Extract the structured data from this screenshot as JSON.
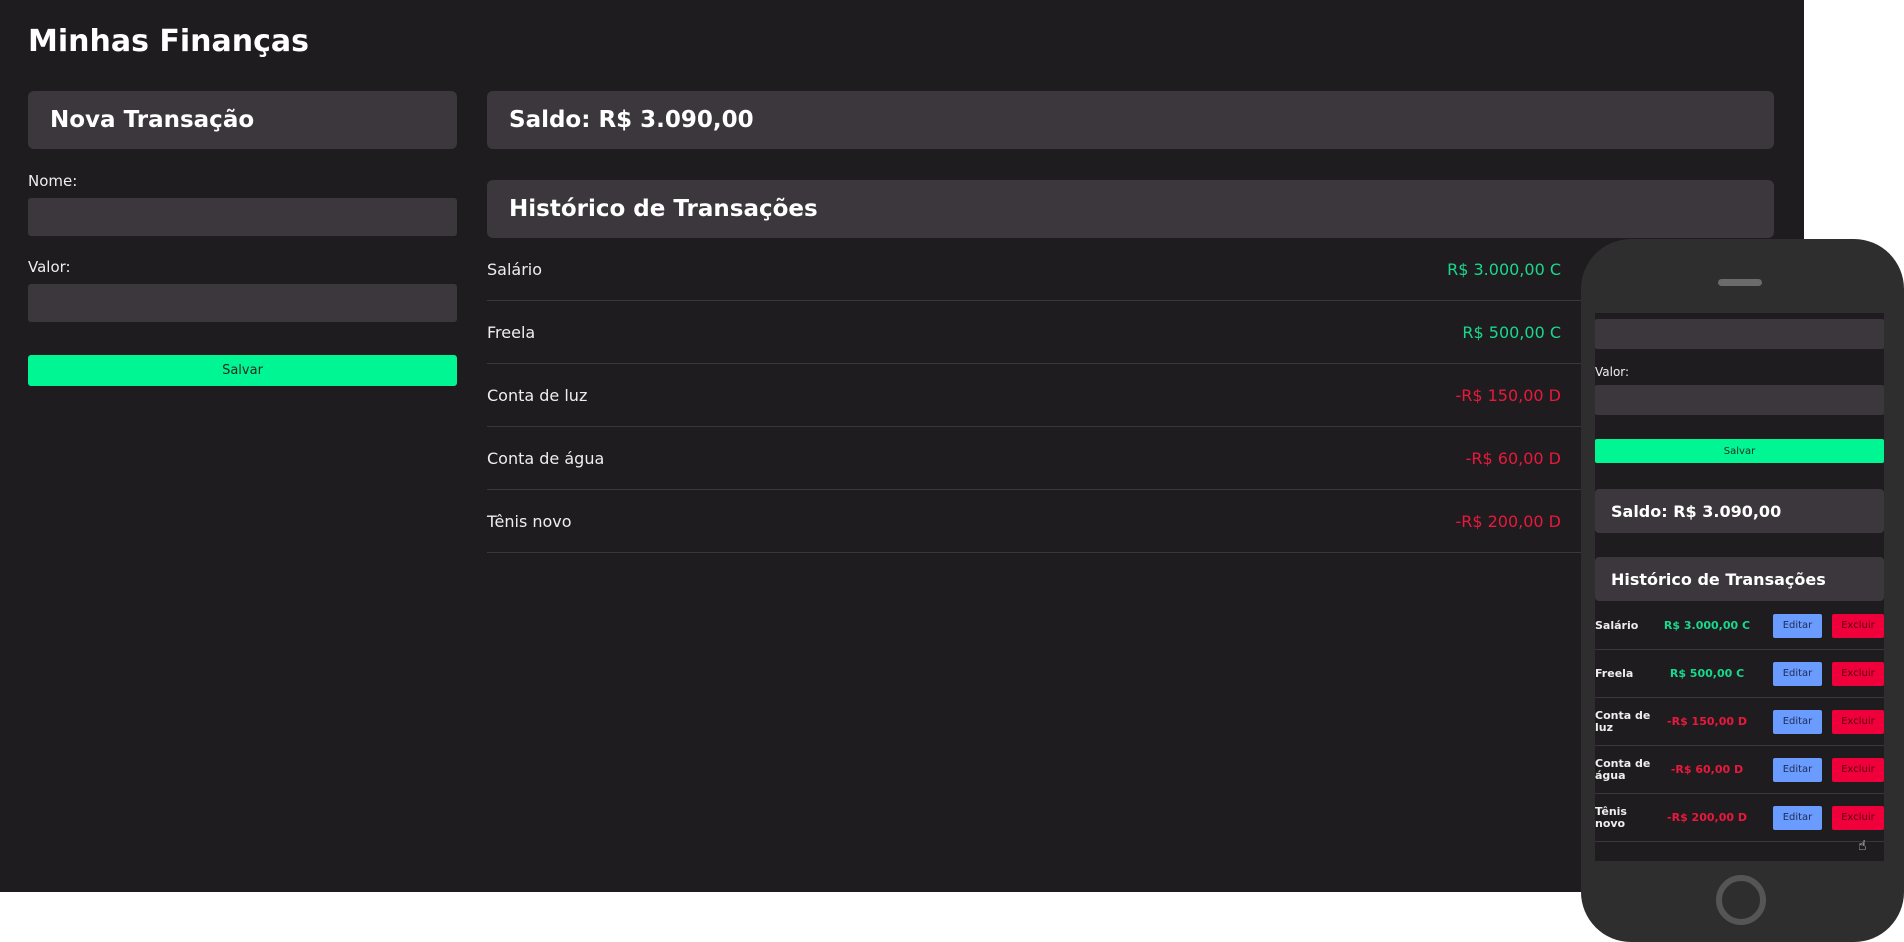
{
  "app": {
    "title": "Minhas Finanças"
  },
  "form": {
    "heading": "Nova Transação",
    "name_label": "Nome:",
    "value_label": "Valor:",
    "save_label": "Salvar"
  },
  "balance": {
    "label": "Saldo: R$ 3.090,00"
  },
  "history": {
    "heading": "Histórico de Transações",
    "items": [
      {
        "name": "Salário",
        "value": "R$ 3.000,00 C",
        "type": "credit"
      },
      {
        "name": "Freela",
        "value": "R$ 500,00 C",
        "type": "credit"
      },
      {
        "name": "Conta de luz",
        "value": "-R$ 150,00 D",
        "type": "debit"
      },
      {
        "name": "Conta de água",
        "value": "-R$ 60,00 D",
        "type": "debit"
      },
      {
        "name": "Tênis novo",
        "value": "-R$ 200,00 D",
        "type": "debit"
      }
    ]
  },
  "mobile": {
    "value_label": "Valor:",
    "save_label": "Salvar",
    "balance": "Saldo: R$ 3.090,00",
    "history_heading": "Histórico de Transações",
    "edit_label": "Editar",
    "delete_label": "Excluir",
    "items": [
      {
        "name": "Salário",
        "value": "R$ 3.000,00 C",
        "type": "credit"
      },
      {
        "name": "Freela",
        "value": "R$ 500,00 C",
        "type": "credit"
      },
      {
        "name": "Conta de luz",
        "value": "-R$ 150,00 D",
        "type": "debit"
      },
      {
        "name": "Conta de água",
        "value": "-R$ 60,00 D",
        "type": "debit"
      },
      {
        "name": "Tênis novo",
        "value": "-R$ 200,00 D",
        "type": "debit"
      }
    ]
  },
  "colors": {
    "credit": "#19d88c",
    "debit": "#e8193c",
    "accent": "#00f593",
    "panel": "#3b373c",
    "background": "#1f1c1f"
  }
}
